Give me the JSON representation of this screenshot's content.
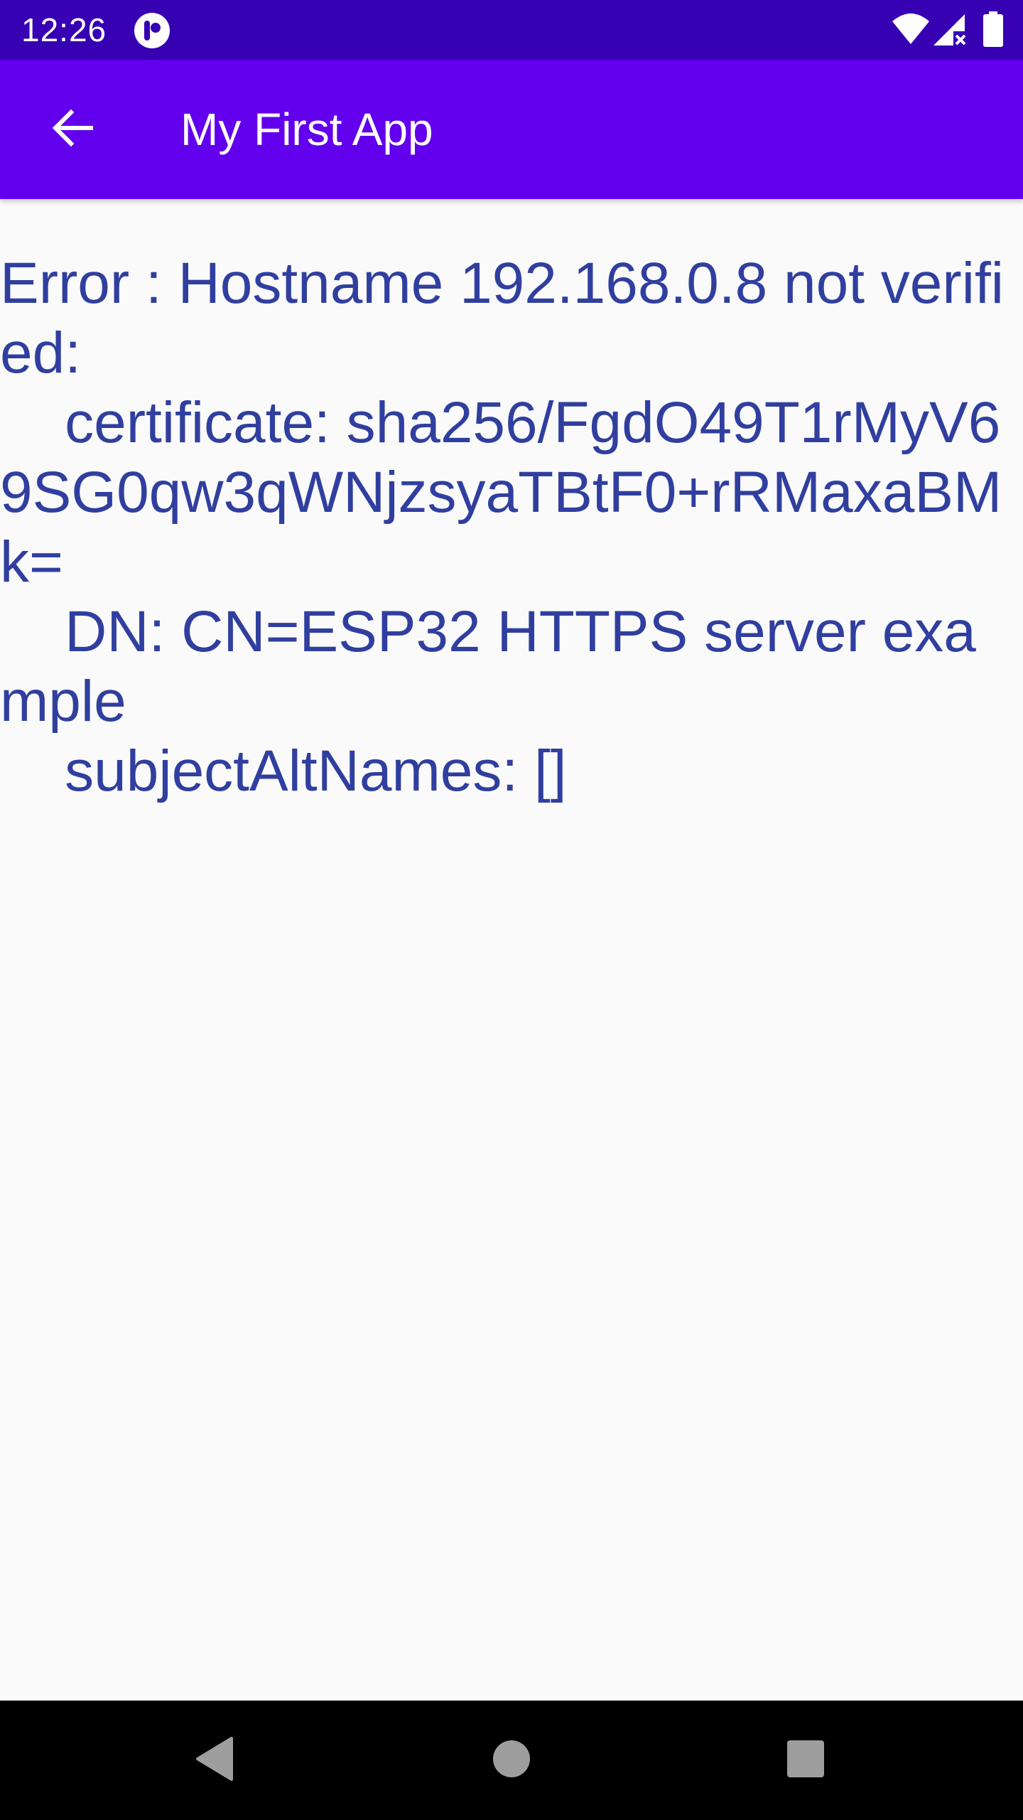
{
  "status_bar": {
    "time": "12:26",
    "background": "#3700b3",
    "icons": [
      "app-notification-icon",
      "wifi-icon",
      "cell-signal-no-data-icon",
      "battery-icon"
    ]
  },
  "app_bar": {
    "title": "My First App",
    "background": "#6200ee",
    "back_icon": "arrow-back-icon"
  },
  "content": {
    "message": "Error : Hostname 192.168.0.8 not verified:\n    certificate: sha256/FgdO49T1rMyV69SG0qw3qWNjzsyaTBtF0+rRMaxaBMk=\n    DN: CN=ESP32 HTTPS server example\n    subjectAltNames: []",
    "text_color": "#303f9f"
  },
  "nav_bar": {
    "buttons": [
      "back-triangle-icon",
      "home-circle-icon",
      "recents-square-icon"
    ],
    "background": "#000000"
  }
}
